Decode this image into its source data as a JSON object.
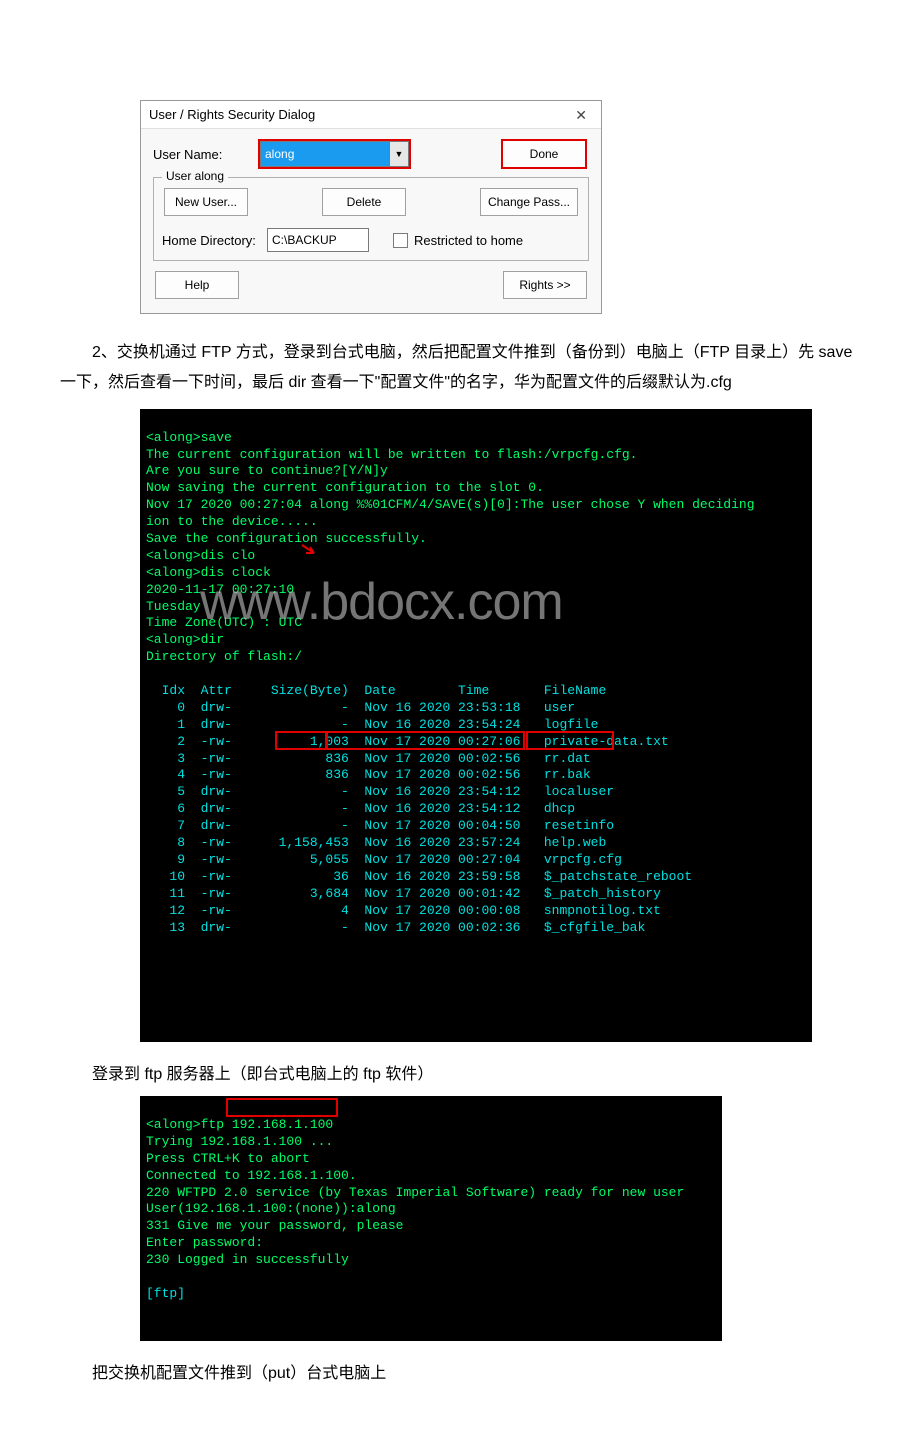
{
  "dialog": {
    "title": "User / Rights Security Dialog",
    "userName_label": "User Name:",
    "userName_value": "along",
    "done_label": "Done",
    "group_legend": "User along",
    "newUser_label": "New User...",
    "delete_label": "Delete",
    "changePass_label": "Change Pass...",
    "homeDir_label": "Home Directory:",
    "homeDir_value": "C:\\BACKUP",
    "restricted_label": "Restricted to home",
    "help_label": "Help",
    "rights_label": "Rights >>"
  },
  "paragraph1": "2、交换机通过 FTP 方式，登录到台式电脑，然后把配置文件推到（备份到）电脑上（FTP 目录上）先 save 一下，然后查看一下时间，最后 dir 查看一下\"配置文件\"的名字，华为配置文件的后缀默认为.cfg",
  "terminal1": {
    "prompt_save": "<along>save",
    "l1": "The current configuration will be written to flash:/vrpcfg.cfg.",
    "l2": "Are you sure to continue?[Y/N]y",
    "l3": "Now saving the current configuration to the slot 0.",
    "l4": "Nov 17 2020 00:27:04 along %%01CFM/4/SAVE(s)[0]:The user chose Y when deciding",
    "l5": "ion to the device.....",
    "l6": "Save the configuration successfully.",
    "prompt_disclo": "<along>dis clo",
    "prompt_disclock": "<along>dis clock",
    "l7": "2020-11-17 00:27:10",
    "l8": "Tuesday",
    "l9": "Time Zone(UTC) : UTC",
    "prompt_dir": "<along>dir",
    "l10": "Directory of flash:/",
    "hdr": "  Idx  Attr     Size(Byte)  Date        Time       FileName",
    "rows": [
      "    0  drw-              -  Nov 16 2020 23:53:18   user",
      "    1  drw-              -  Nov 16 2020 23:54:24   logfile",
      "    2  -rw-          1,003  Nov 17 2020 00:27:06   private-data.txt",
      "    3  -rw-            836  Nov 17 2020 00:02:56   rr.dat",
      "    4  -rw-            836  Nov 17 2020 00:02:56   rr.bak",
      "    5  drw-              -  Nov 16 2020 23:54:12   localuser",
      "    6  drw-              -  Nov 16 2020 23:54:12   dhcp",
      "    7  drw-              -  Nov 17 2020 00:04:50   resetinfo",
      "    8  -rw-      1,158,453  Nov 16 2020 23:57:24   help.web",
      "    9  -rw-          5,055  Nov 17 2020 00:27:04   vrpcfg.cfg",
      "   10  -rw-             36  Nov 16 2020 23:59:58   $_patchstate_reboot",
      "   11  -rw-          3,684  Nov 17 2020 00:01:42   $_patch_history",
      "   12  -rw-              4  Nov 17 2020 00:00:08   snmpnotilog.txt",
      "   13  drw-              -  Nov 17 2020 00:02:36   $_cfgfile_bak"
    ],
    "watermark": "www.bdocx.com"
  },
  "paragraph2": "登录到 ftp 服务器上（即台式电脑上的 ftp 软件）",
  "terminal2": {
    "l0": "<along>ftp 192.168.1.100",
    "l1": "Trying 192.168.1.100 ...",
    "l2": "Press CTRL+K to abort",
    "l3": "Connected to 192.168.1.100.",
    "l4": "220 WFTPD 2.0 service (by Texas Imperial Software) ready for new user",
    "l5": "User(192.168.1.100:(none)):along",
    "l6": "331 Give me your password, please",
    "l7": "Enter password:",
    "l8": "230 Logged in successfully",
    "l9": "",
    "l10": "[ftp]"
  },
  "paragraph3": "把交换机配置文件推到（put）台式电脑上"
}
